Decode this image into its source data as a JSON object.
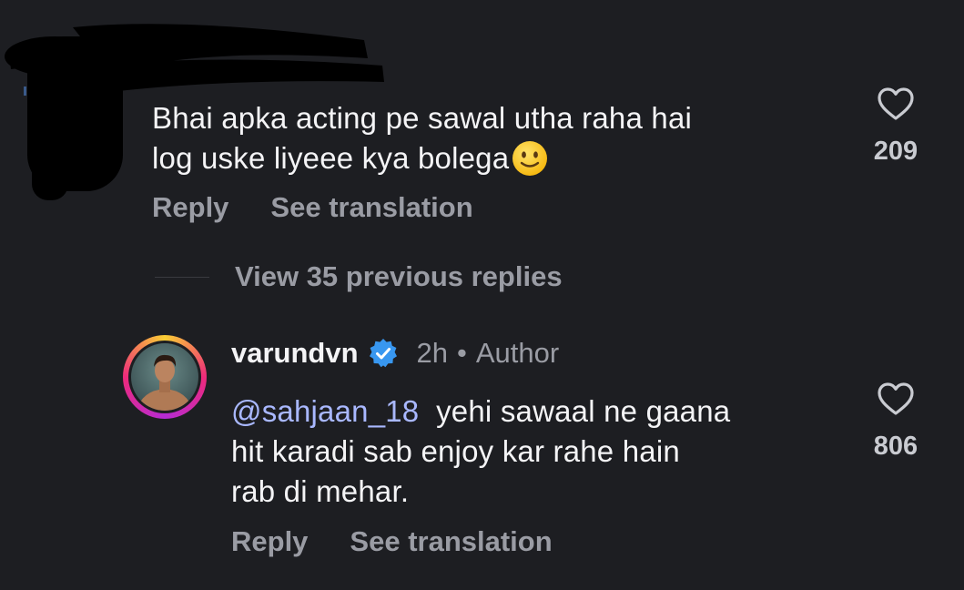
{
  "comment": {
    "lines": [
      "Bhai apka acting pe sawal utha raha hai",
      "log uske liyeee kya bolega"
    ],
    "emoji": "slightly-smiling-face-emoji",
    "reply_label": "Reply",
    "translate_label": "See translation",
    "likes": "209"
  },
  "view_replies_label": "View 35 previous replies",
  "reply": {
    "username": "varundvn",
    "verified_icon": "verified-badge-icon",
    "time": "2h",
    "separator": "•",
    "author_tag": "Author",
    "mention": "@sahjaan_18",
    "line1_rest": "yehi sawaal ne gaana",
    "line2": "hit karadi sab enjoy kar rahe hain",
    "line3": "rab di mehar.",
    "reply_label": "Reply",
    "translate_label": "See translation",
    "likes": "806"
  },
  "icons": {
    "heart": "heart-outline-icon"
  },
  "colors": {
    "background": "#1d1e22",
    "text": "#f4f4f6",
    "secondary": "#9a9ca4",
    "mention": "#a9b8ff",
    "verified": "#3897f0"
  }
}
